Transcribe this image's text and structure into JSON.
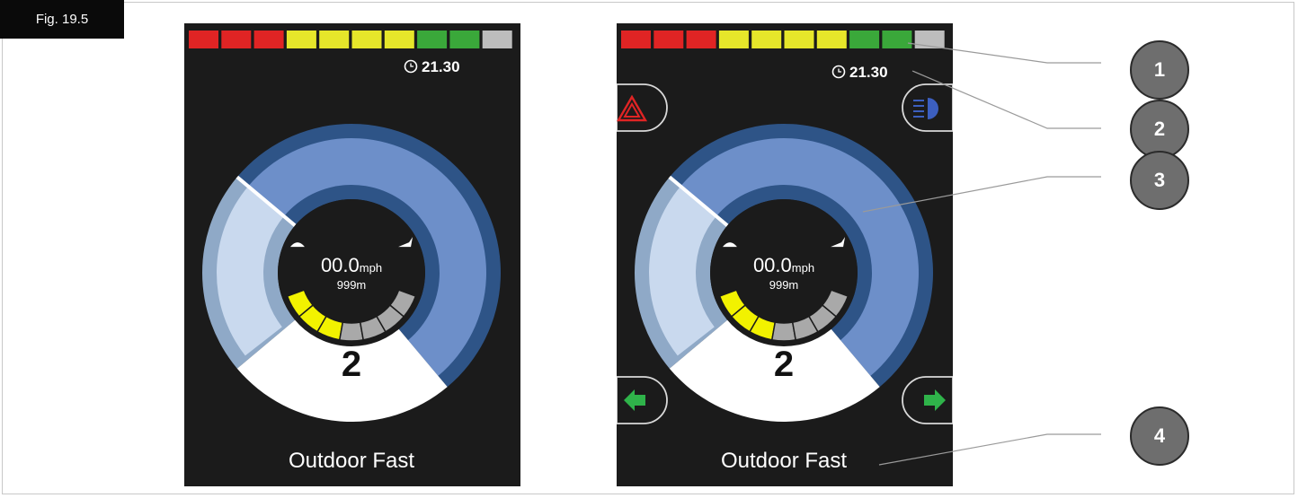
{
  "figure": {
    "label": "Fig. 19.5"
  },
  "display": {
    "time": "21.30",
    "speed_value": "00.0",
    "speed_unit": "mph",
    "distance": "999m",
    "profile_number": "2",
    "profile_name": "Outdoor Fast",
    "battery_colors": [
      "#e02424",
      "#e02424",
      "#e02424",
      "#e6e62a",
      "#e6e62a",
      "#e6e62a",
      "#e6e62a",
      "#3aa83a",
      "#3aa83a",
      "#bdbdbd"
    ],
    "speed_limit_colors": {
      "active": "#f2f200",
      "inactive": "#a9a9a9"
    },
    "speed_limit_level": 0.4,
    "arc_colors": {
      "speed_range": "#6d8fc9",
      "speed_range_dark": "#2e5487",
      "current": "#c9d9ee"
    }
  },
  "callouts": [
    "1",
    "2",
    "3",
    "4"
  ],
  "icons": {
    "hazard": "hazard-warning-icon",
    "lights": "headlight-icon",
    "left_indicator": "left-indicator-arrow-icon",
    "right_indicator": "right-indicator-arrow-icon",
    "tortoise": "tortoise-icon",
    "hare": "hare-icon",
    "clock": "clock-icon"
  }
}
